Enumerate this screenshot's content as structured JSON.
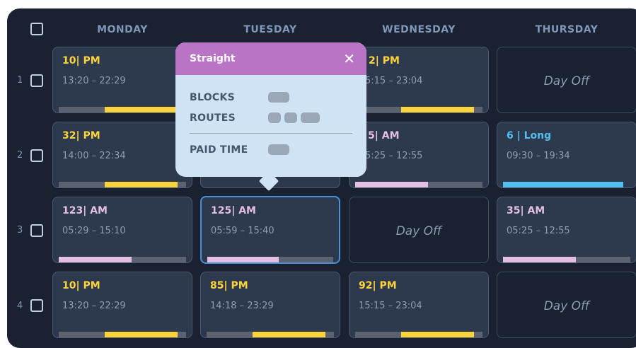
{
  "header": {
    "days": [
      "MONDAY",
      "TUESDAY",
      "WEDNESDAY",
      "THURSDAY"
    ]
  },
  "rows": [
    {
      "num": "1",
      "cells": [
        {
          "code": "10| PM",
          "time": "13:20 – 22:29"
        },
        {
          "code": "",
          "time": ""
        },
        {
          "code": "2| PM",
          "time": "5:15 – 23:04"
        },
        {
          "off": "Day Off"
        }
      ]
    },
    {
      "num": "2",
      "cells": [
        {
          "code": "32| PM",
          "time": "14:00 – 22:34"
        },
        {
          "code": "",
          "time": ""
        },
        {
          "code": "5| AM",
          "time": "5:25 – 12:55"
        },
        {
          "code": "6 | Long",
          "time": "09:30 – 19:34"
        }
      ]
    },
    {
      "num": "3",
      "cells": [
        {
          "code": "123| AM",
          "time": "05:29 – 15:10"
        },
        {
          "code": "125| AM",
          "time": "05:59 – 15:40"
        },
        {
          "off": "Day Off"
        },
        {
          "code": "35| AM",
          "time": "05:25 – 12:55"
        }
      ]
    },
    {
      "num": "4",
      "cells": [
        {
          "code": "10| PM",
          "time": "13:20 – 22:29"
        },
        {
          "code": "85| PM",
          "time": "14:18 – 23:29"
        },
        {
          "code": "92| PM",
          "time": "15:15 – 23:04"
        },
        {
          "off": "Day Off"
        }
      ]
    }
  ],
  "popup": {
    "title": "Straight",
    "close": "✕",
    "blocks_label": "BLOCKS",
    "routes_label": "ROUTES",
    "paid_label": "PAID TIME"
  },
  "colors": {
    "pm": "#ffd33c",
    "am_bar": "#e3bfe6",
    "long": "#52bff0",
    "popup_header": "#b974c6",
    "selected_border": "#4a90d9"
  }
}
